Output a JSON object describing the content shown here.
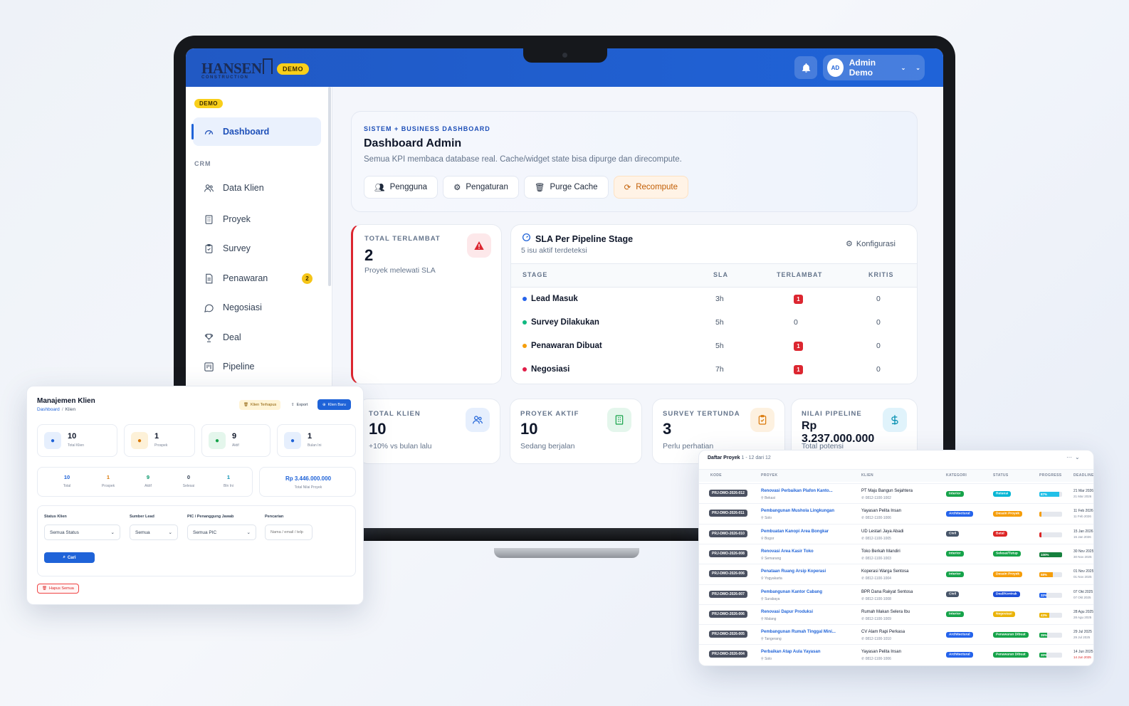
{
  "app": {
    "logo_text": "HANSEN",
    "logo_sub": "CONSTRUCTION",
    "demo_badge": "DEMO",
    "user_initials": "AD",
    "user_name": "Admin Demo"
  },
  "sidebar": {
    "demo_badge": "DEMO",
    "dashboard": "Dashboard",
    "section_crm": "CRM",
    "items": [
      {
        "label": "Data Klien",
        "icon": "users-icon"
      },
      {
        "label": "Proyek",
        "icon": "building-icon"
      },
      {
        "label": "Survey",
        "icon": "clipboard-icon"
      },
      {
        "label": "Penawaran",
        "icon": "document-icon",
        "badge": "2"
      },
      {
        "label": "Negosiasi",
        "icon": "chat-icon"
      },
      {
        "label": "Deal",
        "icon": "trophy-icon"
      },
      {
        "label": "Pipeline",
        "icon": "kanban-icon"
      }
    ]
  },
  "hero": {
    "eyebrow": "SISTEM + BUSINESS DASHBOARD",
    "title": "Dashboard Admin",
    "desc": "Semua KPI membaca database real. Cache/widget state bisa dipurge dan direcompute.",
    "buttons": [
      "Pengguna",
      "Pengaturan",
      "Purge Cache",
      "Recompute"
    ]
  },
  "late": {
    "label": "TOTAL TERLAMBAT",
    "value": "2",
    "sub": "Proyek melewati SLA"
  },
  "sla": {
    "title": "SLA Per Pipeline Stage",
    "subtitle": "5 isu aktif terdeteksi",
    "config": "Konfigurasi",
    "headers": [
      "STAGE",
      "SLA",
      "TERLAMBAT",
      "KRITIS"
    ],
    "rows": [
      {
        "stage": "Lead Masuk",
        "color": "#2563eb",
        "sla": "3h",
        "late": "1",
        "late_badge": true,
        "crit": "0"
      },
      {
        "stage": "Survey Dilakukan",
        "color": "#10b981",
        "sla": "5h",
        "late": "0",
        "late_badge": false,
        "crit": "0"
      },
      {
        "stage": "Penawaran Dibuat",
        "color": "#f59e0b",
        "sla": "5h",
        "late": "1",
        "late_badge": true,
        "crit": "0"
      },
      {
        "stage": "Negosiasi",
        "color": "#e11d48",
        "sla": "7h",
        "late": "1",
        "late_badge": true,
        "crit": "0"
      }
    ]
  },
  "kpis": [
    {
      "label": "TOTAL KLIEN",
      "value": "10",
      "sub": "+10% vs bulan lalu",
      "icon": "users-icon"
    },
    {
      "label": "PROYEK AKTIF",
      "value": "10",
      "sub": "Sedang berjalan",
      "icon": "building-icon"
    },
    {
      "label": "SURVEY TERTUNDA",
      "value": "3",
      "sub": "Perlu perhatian",
      "icon": "clipboard-icon"
    },
    {
      "label": "NILAI PIPELINE",
      "value": "Rp 3.237.000.000",
      "sub": "Total potensi",
      "icon": "dollar-icon"
    }
  ],
  "klien": {
    "title": "Manajemen Klien",
    "crumb_home": "Dashboard",
    "crumb_sep": "/",
    "crumb_current": "Klien",
    "btn_deleted": "Klien Terhapus",
    "btn_export": "Export",
    "btn_new": "Klien Baru",
    "stats": [
      {
        "value": "10",
        "label": "Total Klien"
      },
      {
        "value": "1",
        "label": "Prospek"
      },
      {
        "value": "9",
        "label": "Aktif"
      },
      {
        "value": "1",
        "label": "Bulan Ini"
      }
    ],
    "summary": [
      {
        "value": "10",
        "label": "Total",
        "color": "#1f63d8"
      },
      {
        "value": "1",
        "label": "Prospek",
        "color": "#d97706"
      },
      {
        "value": "9",
        "label": "Aktif",
        "color": "#059669"
      },
      {
        "value": "0",
        "label": "Selesai",
        "color": "#334155"
      },
      {
        "value": "1",
        "label": "Bln Ini",
        "color": "#0891b2"
      }
    ],
    "total_value": "Rp 3.446.000.000",
    "total_label": "Total Nilai Proyek",
    "filters": [
      {
        "label": "Status Klien",
        "value": "Semua Status"
      },
      {
        "label": "Sumber Lead",
        "value": "Semua"
      },
      {
        "label": "PIC / Penanggung Jawab",
        "value": "Semua PIC"
      },
      {
        "label": "Pencarian",
        "placeholder": "Nama / email / telp"
      }
    ],
    "search_btn": "Cari",
    "delete_all": "Hapus Semua"
  },
  "proyek": {
    "title": "Daftar Proyek",
    "count": "1 - 12 dari 12",
    "menu": "···",
    "headers": [
      "KODE",
      "PROYEK",
      "KLIEN",
      "KATEGORI",
      "STATUS",
      "PROGRESS",
      "DEADLINE"
    ],
    "rows": [
      {
        "kode": "PRJ-DMO-2026-012",
        "nama": "Renovasi Perbaikan Plafon Kanto...",
        "lokasi": "Bekasi",
        "klien": "PT Maju Bangun Sejahtera",
        "telp": "0812-1100-1002",
        "kategori": "Interior",
        "kat_color": "#16a34a",
        "status": "Retensi",
        "status_color": "#06b6d4",
        "progress": "87%",
        "prog_val": 87,
        "prog_color": "#22c0e8",
        "deadline": "21 Mar 2026",
        "dl2": "21 Mar 2026"
      },
      {
        "kode": "PRJ-DMO-2026-011",
        "nama": "Pembangunan Mushola Lingkungan",
        "lokasi": "Solo",
        "klien": "Yayasan Pelita Insan",
        "telp": "0812-1100-1006",
        "kategori": "Architectural",
        "kat_color": "#2563eb",
        "status": "Desain Proyek",
        "status_color": "#f59e0b",
        "progress": "",
        "prog_val": 10,
        "prog_color": "#f59e0b",
        "deadline": "11 Feb 2026",
        "dl2": "11 Feb 2026"
      },
      {
        "kode": "PRJ-DMO-2026-010",
        "nama": "Pembuatan Kanopi Area Bongkar",
        "lokasi": "Bogor",
        "klien": "UD Lestari Jaya Abadi",
        "telp": "0812-1100-1005",
        "kategori": "Civil",
        "kat_color": "#475569",
        "status": "Batal",
        "status_color": "#dc2626",
        "progress": "",
        "prog_val": 10,
        "prog_color": "#dc2626",
        "deadline": "15 Jan 2026",
        "dl2": "15 Jan 2026"
      },
      {
        "kode": "PRJ-DMO-2026-008",
        "nama": "Renovasi Area Kasir Toko",
        "lokasi": "Semarang",
        "klien": "Toko Berkah Mandiri",
        "telp": "0812-1100-1003",
        "kategori": "Interior",
        "kat_color": "#16a34a",
        "status": "Selesai/Tutup",
        "status_color": "#16a34a",
        "progress": "100%",
        "prog_val": 100,
        "prog_color": "#15803d",
        "deadline": "30 Nov 2025",
        "dl2": "30 Nov 2025"
      },
      {
        "kode": "PRJ-DMO-2026-006",
        "nama": "Penataan Ruang Arsip Koperasi",
        "lokasi": "Yogyakarta",
        "klien": "Koperasi Warga Sentosa",
        "telp": "0812-1100-1004",
        "kategori": "Interior",
        "kat_color": "#16a34a",
        "status": "Desain Proyek",
        "status_color": "#f59e0b",
        "progress": "58%",
        "prog_val": 58,
        "prog_color": "#f59e0b",
        "deadline": "01 Nov 2025",
        "dl2": "01 Nov 2025"
      },
      {
        "kode": "PRJ-DMO-2026-007",
        "nama": "Pembangunan Kantor Cabang",
        "lokasi": "Surabaya",
        "klien": "BPR Dana Rakyat Sentosa",
        "telp": "0812-1100-1008",
        "kategori": "Civil",
        "kat_color": "#475569",
        "status": "Deal/Kontrak",
        "status_color": "#1d4ed8",
        "progress": "32%",
        "prog_val": 32,
        "prog_color": "#2563eb",
        "deadline": "07 Okt 2025",
        "dl2": "07 Okt 2025"
      },
      {
        "kode": "PRJ-DMO-2026-006",
        "nama": "Renovasi Dapur Produksi",
        "lokasi": "Malang",
        "klien": "Rumah Makan Selera Ibu",
        "telp": "0812-1100-1009",
        "kategori": "Interior",
        "kat_color": "#16a34a",
        "status": "Negosiasi",
        "status_color": "#eab308",
        "progress": "43%",
        "prog_val": 43,
        "prog_color": "#eab308",
        "deadline": "28 Agu 2025",
        "dl2": "28 Agu 2025"
      },
      {
        "kode": "PRJ-DMO-2026-005",
        "nama": "Pembangunan Rumah Tinggal Mini...",
        "lokasi": "Tangerang",
        "klien": "CV Alam Rapi Perkasa",
        "telp": "0812-1100-1010",
        "kategori": "Architectural",
        "kat_color": "#2563eb",
        "status": "Penawaran Dibuat",
        "status_color": "#16a34a",
        "progress": "35%",
        "prog_val": 35,
        "prog_color": "#16a34a",
        "deadline": "29 Jul 2025",
        "dl2": "29 Jul 2025"
      },
      {
        "kode": "PRJ-DMO-2026-004",
        "nama": "Perbaikan Atap Aula Yayasan",
        "lokasi": "Solo",
        "klien": "Yayasan Pelita Insan",
        "telp": "0812-1100-1006",
        "kategori": "Architectural",
        "kat_color": "#2563eb",
        "status": "Penawaran Dibuat",
        "status_color": "#16a34a",
        "progress": "30%",
        "prog_val": 30,
        "prog_color": "#16a34a",
        "deadline": "14 Jun 2025",
        "dl2": "14 Jun 2025"
      }
    ]
  }
}
